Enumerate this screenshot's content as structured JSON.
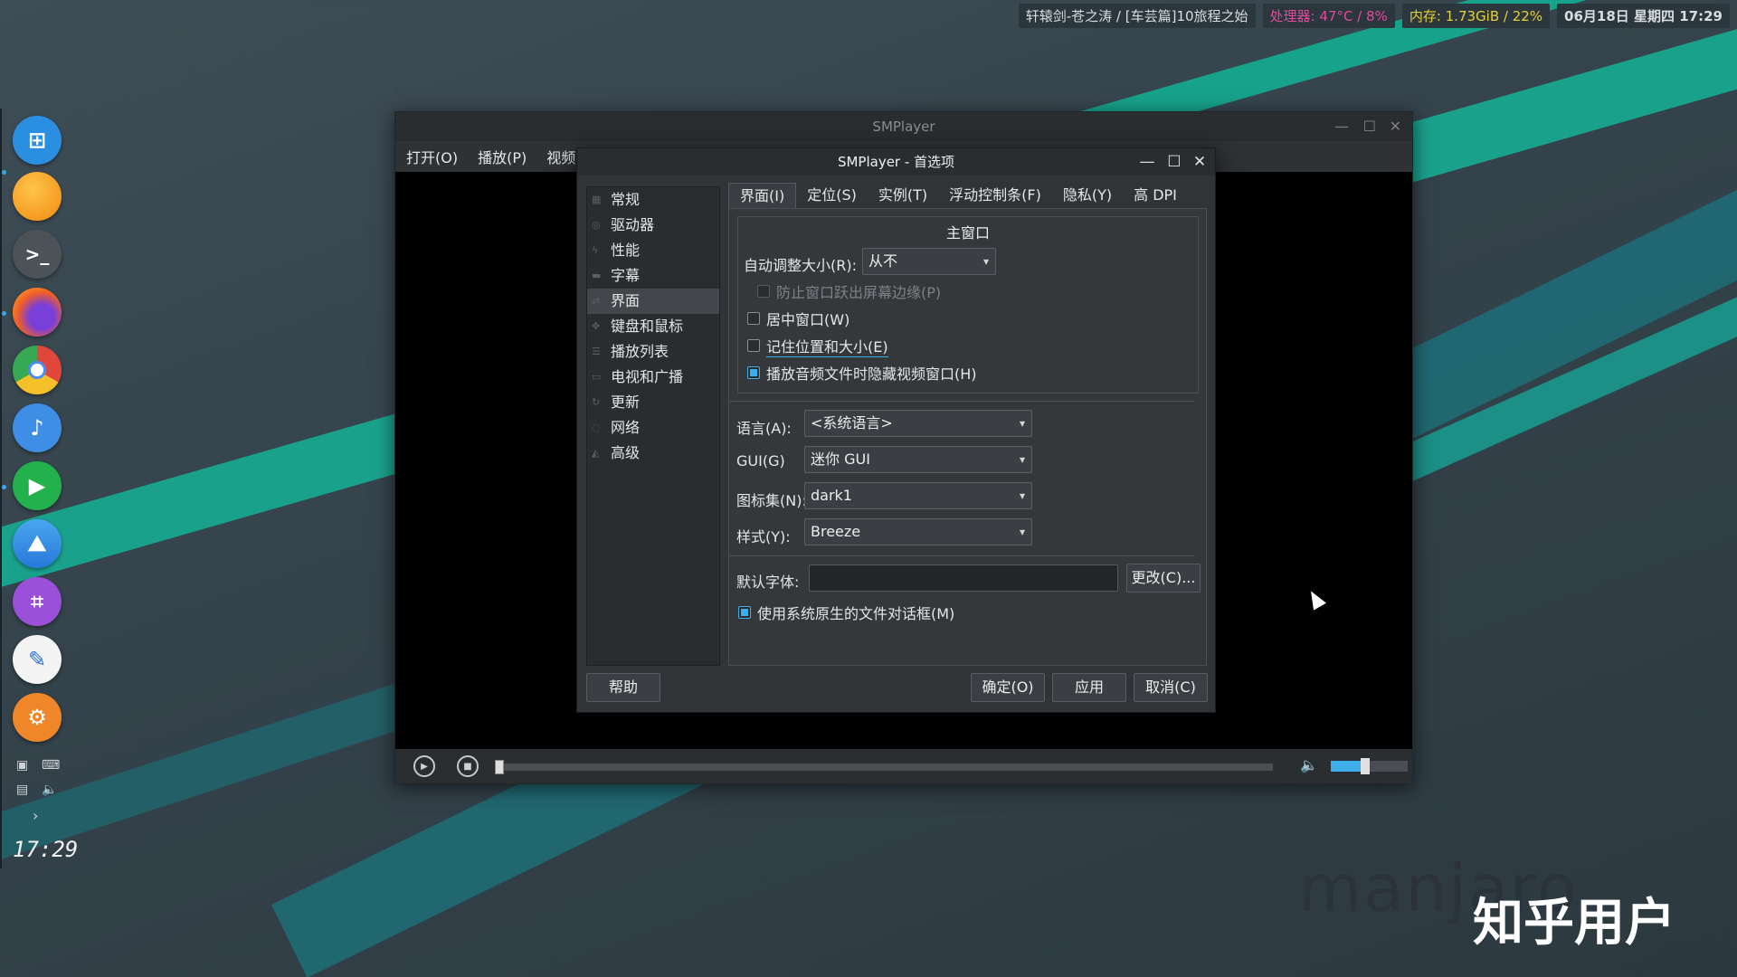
{
  "topbar": {
    "media": "轩辕剑-苍之涛 / [车芸篇]10旅程之始",
    "cpu": "处理器: 47°C / 8%",
    "mem": "内存: 1.73GiB / 22%",
    "datetime": "06月18日 星期四 17:29"
  },
  "dock": {
    "items": [
      "windows-icon",
      "files-icon",
      "terminal-icon",
      "firefox-icon",
      "chrome-icon",
      "music-icon",
      "video-player-icon",
      "image-viewer-icon",
      "crop-tool-icon",
      "text-editor-icon",
      "settings-icon"
    ],
    "clock": "17:29"
  },
  "main_window": {
    "title": "SMPlayer",
    "menu": [
      "打开(O)",
      "播放(P)",
      "视频"
    ]
  },
  "player": {
    "volume_level": 0.45
  },
  "dialog": {
    "title": "SMPlayer - 首选项",
    "sidebar": [
      "常规",
      "驱动器",
      "性能",
      "字幕",
      "界面",
      "键盘和鼠标",
      "播放列表",
      "电视和广播",
      "更新",
      "网络",
      "高级"
    ],
    "sidebar_selected": "界面",
    "tabs": [
      "界面(I)",
      "定位(S)",
      "实例(T)",
      "浮动控制条(F)",
      "隐私(Y)",
      "高 DPI"
    ],
    "main_window_group": {
      "title": "主窗口",
      "auto_resize_label": "自动调整大小(R):",
      "auto_resize_value": "从不",
      "prevent_off_screen": "防止窗口跃出屏幕边缘(P)",
      "center_window": "居中窗口(W)",
      "remember_pos": "记住位置和大小(E)",
      "hide_video_on_audio": "播放音频文件时隐藏视频窗口(H)"
    },
    "language_label": "语言(A):",
    "language_value": "<系统语言>",
    "gui_label": "GUI(G)",
    "gui_value": "迷你 GUI",
    "iconset_label": "图标集(N):",
    "iconset_value": "dark1",
    "style_label": "样式(Y):",
    "style_value": "Breeze",
    "default_font_label": "默认字体:",
    "default_font_value": "",
    "change_button": "更改(C)...",
    "native_dialog": "使用系统原生的文件对话框(M)",
    "help_button": "帮助",
    "ok_button": "确定(O)",
    "apply_button": "应用",
    "cancel_button": "取消(C)"
  },
  "watermarks": {
    "manjaro": "manjaro",
    "zhihu": "知乎用户"
  }
}
